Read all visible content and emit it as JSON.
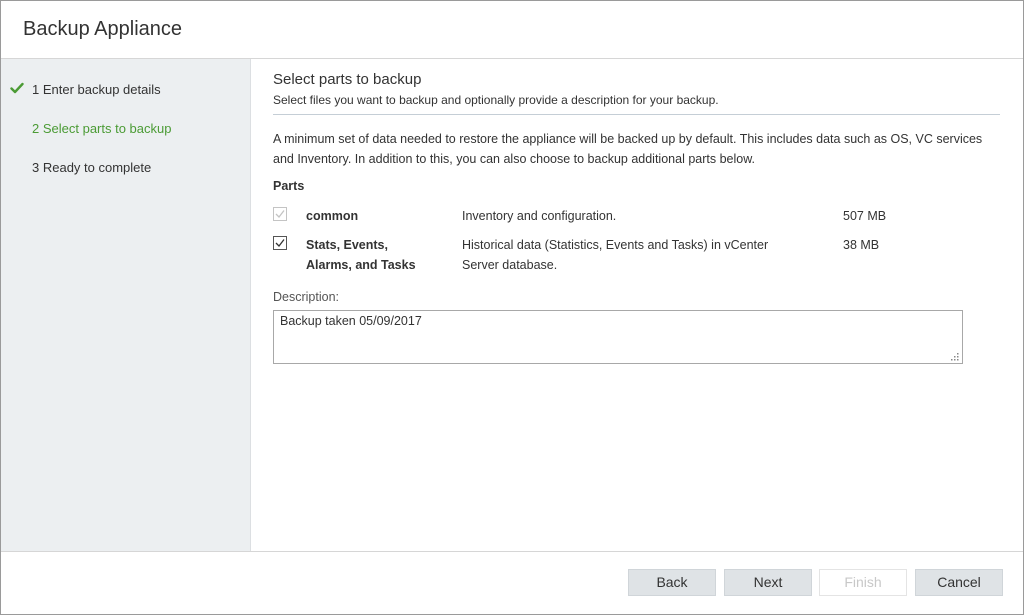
{
  "window": {
    "title": "Backup Appliance"
  },
  "steps": [
    {
      "label": "1 Enter backup details",
      "state": "completed"
    },
    {
      "label": "2 Select parts to backup",
      "state": "active"
    },
    {
      "label": "3 Ready to complete",
      "state": "pending"
    }
  ],
  "section": {
    "title": "Select parts to backup",
    "subtitle": "Select files you want to backup and optionally provide a description for your backup.",
    "intro": "A minimum set of data needed to restore the appliance will be backed up by default. This includes data such as OS, VC services and Inventory. In addition to this, you can also choose to backup additional parts below."
  },
  "parts": {
    "heading": "Parts",
    "items": [
      {
        "name": "common",
        "description": "Inventory and configuration.",
        "size": "507 MB",
        "checked": true,
        "disabled": true
      },
      {
        "name": "Stats, Events, Alarms, and Tasks",
        "description": "Historical data (Statistics, Events and Tasks) in vCenter Server database.",
        "size": "38 MB",
        "checked": true,
        "disabled": false
      }
    ]
  },
  "description": {
    "label": "Description:",
    "value": "Backup taken 05/09/2017"
  },
  "buttons": {
    "back": "Back",
    "next": "Next",
    "finish": "Finish",
    "cancel": "Cancel"
  },
  "colors": {
    "active_step": "#4b9b35",
    "sidebar_bg": "#eceff1",
    "button_bg": "#dfe3e6"
  },
  "icons": {
    "completed_step": "checkmark-icon",
    "checkbox_checked": "check-icon",
    "textarea_resize": "resize-grip-icon"
  }
}
